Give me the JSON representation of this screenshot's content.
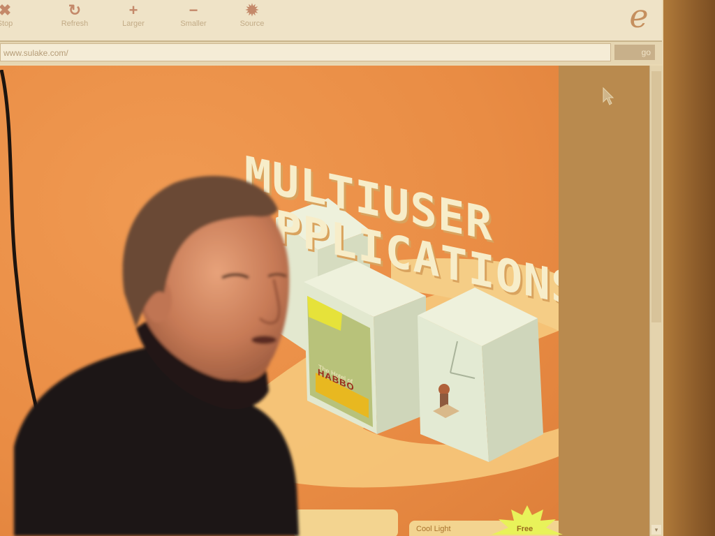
{
  "scene": {
    "type": "photograph of a projected web browser with a presenter"
  },
  "browser": {
    "toolbar": {
      "buttons": [
        {
          "label": "Stop",
          "icon": "stop-icon"
        },
        {
          "label": "Refresh",
          "icon": "refresh-icon"
        },
        {
          "label": "Larger",
          "icon": "plus-icon"
        },
        {
          "label": "Smaller",
          "icon": "minus-icon"
        },
        {
          "label": "Source",
          "icon": "gear-icon"
        }
      ],
      "logo": "e"
    },
    "address": {
      "url": "www.sulake.com/",
      "go_label": "go"
    }
  },
  "page": {
    "headline_line1": "MULTIUSER",
    "headline_line2": "APPLICATIONS",
    "game_logo": "HABBO",
    "box_caption": "The Hotel of",
    "tab_left_label": "",
    "tab_right_label": "Cool Light",
    "badge_label": "Free"
  },
  "colors": {
    "page_bg": "#e98c44",
    "headline": "#f7edc9",
    "servers": "#e6ecd6",
    "presenter_sweater": "#1a1212"
  }
}
